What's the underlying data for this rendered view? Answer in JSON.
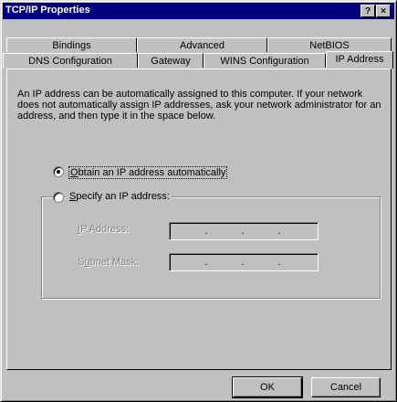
{
  "window": {
    "title": "TCP/IP Properties",
    "help_glyph": "?",
    "close_glyph": "×"
  },
  "tabs_row1": [
    {
      "label": "Bindings"
    },
    {
      "label": "Advanced"
    },
    {
      "label": "NetBIOS"
    }
  ],
  "tabs_row2": [
    {
      "label": "DNS Configuration"
    },
    {
      "label": "Gateway"
    },
    {
      "label": "WINS Configuration"
    },
    {
      "label": "IP Address"
    }
  ],
  "panel": {
    "description": "An IP address can be automatically assigned to this computer. If your network does not automatically assign IP addresses, ask your network administrator for an address, and then type it in the space below.",
    "obtain_auto": {
      "underline": "O",
      "rest": "btain an IP address automatically",
      "selected": true
    },
    "specify": {
      "underline": "S",
      "rest": "pecify an IP address:",
      "selected": false
    },
    "ip_label": {
      "underline": "I",
      "rest": "P Address:"
    },
    "mask_label": {
      "pre": "S",
      "underline": "u",
      "rest": "bnet Mask:"
    },
    "dot": "."
  },
  "buttons": {
    "ok": "OK",
    "cancel": "Cancel"
  },
  "colors": {
    "titlebar": "#000080",
    "face": "#c0c0c0",
    "disabled_text": "#808080"
  }
}
